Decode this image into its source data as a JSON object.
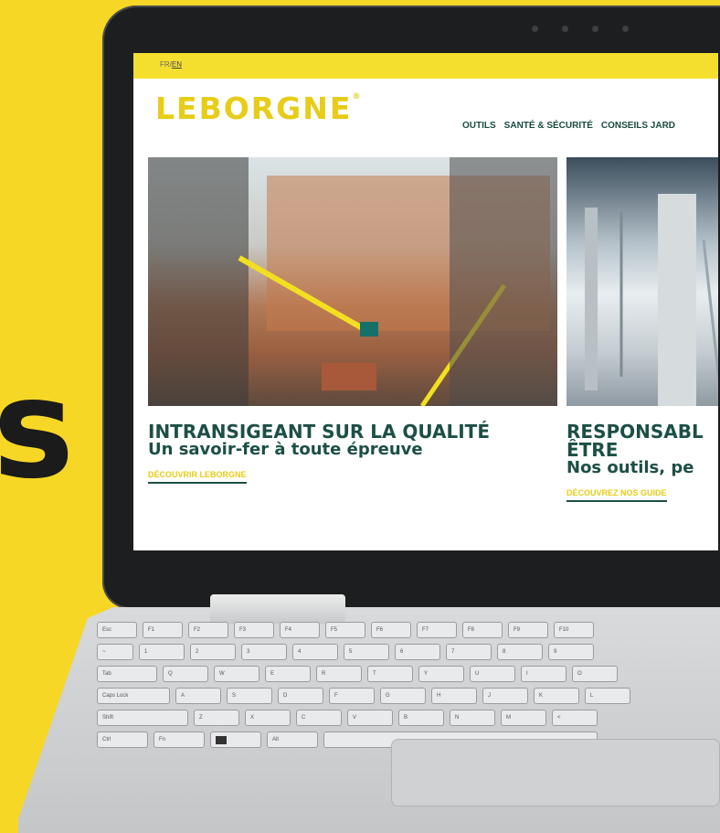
{
  "background": {
    "color": "#f7d726",
    "partial_text": "s"
  },
  "site": {
    "lang": {
      "fr": "FR",
      "separator": "/",
      "en": "EN"
    },
    "logo": "LEBORGNE",
    "logo_mark": "®",
    "nav": [
      "OUTILS",
      "SANTÉ & SÉCURITÉ",
      "CONSEILS JARD"
    ],
    "cards": [
      {
        "title": "INTRANSIGEANT SUR LA QUALITÉ",
        "subtitle": "Un savoir-fer à toute épreuve",
        "cta": "DÉCOUVRIR LEBORGNE"
      },
      {
        "title": "RESPONSABL",
        "title2": "ÊTRE",
        "subtitle": "Nos outils, pe",
        "cta": "DÉCOUVREZ NOS GUIDE"
      }
    ],
    "colors": {
      "accent": "#e7cc18",
      "text": "#1c4f46",
      "topbar": "#f5df2e"
    }
  },
  "keyboard": {
    "rows": [
      [
        "Esc",
        "F1",
        "F2",
        "F3",
        "F4",
        "F5",
        "F6",
        "F7",
        "F8",
        "F9",
        "F10"
      ],
      [
        "~",
        "1",
        "2",
        "3",
        "4",
        "5",
        "6",
        "7",
        "8",
        "9"
      ],
      [
        "Tab",
        "Q",
        "W",
        "E",
        "R",
        "T",
        "Y",
        "U",
        "I",
        "O"
      ],
      [
        "Caps Lock",
        "A",
        "S",
        "D",
        "F",
        "G",
        "H",
        "J",
        "K",
        "L"
      ],
      [
        "Shift",
        "Z",
        "X",
        "C",
        "V",
        "B",
        "N",
        "M",
        "<"
      ],
      [
        "Ctrl",
        "Fn",
        "win",
        "Alt",
        "",
        ""
      ]
    ]
  }
}
